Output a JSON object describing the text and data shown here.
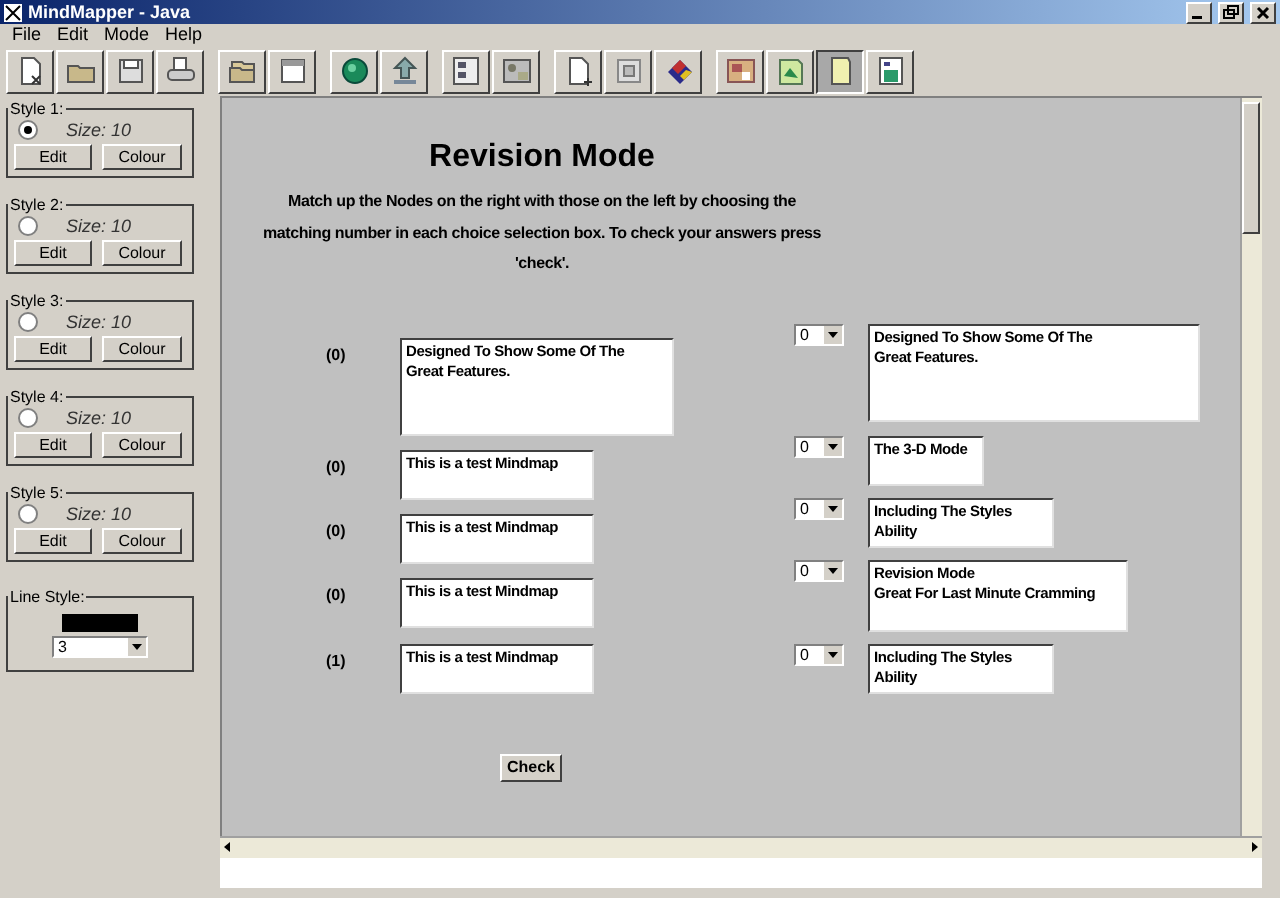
{
  "window": {
    "title": "MindMapper - Java"
  },
  "menu": [
    "File",
    "Edit",
    "Mode",
    "Help"
  ],
  "toolbar": [
    {
      "selected": false
    },
    {
      "selected": false
    },
    {
      "selected": false
    },
    {
      "selected": false
    },
    {
      "selected": false
    },
    {
      "selected": false
    },
    {
      "selected": false
    },
    {
      "selected": false
    },
    {
      "selected": false
    },
    {
      "selected": false
    },
    {
      "selected": false
    },
    {
      "selected": false
    },
    {
      "selected": false
    },
    {
      "selected": false
    },
    {
      "selected": false
    },
    {
      "selected": true
    },
    {
      "selected": false
    }
  ],
  "styles": [
    {
      "legend": "Style 1:",
      "selected": true,
      "size_label": "Size:",
      "size": "10",
      "edit": "Edit",
      "colour": "Colour"
    },
    {
      "legend": "Style 2:",
      "selected": false,
      "size_label": "Size:",
      "size": "10",
      "edit": "Edit",
      "colour": "Colour"
    },
    {
      "legend": "Style 3:",
      "selected": false,
      "size_label": "Size:",
      "size": "10",
      "edit": "Edit",
      "colour": "Colour"
    },
    {
      "legend": "Style 4:",
      "selected": false,
      "size_label": "Size:",
      "size": "10",
      "edit": "Edit",
      "colour": "Colour"
    },
    {
      "legend": "Style 5:",
      "selected": false,
      "size_label": "Size:",
      "size": "10",
      "edit": "Edit",
      "colour": "Colour"
    }
  ],
  "line_style": {
    "legend": "Line Style:",
    "value": "3"
  },
  "revision": {
    "title": "Revision Mode",
    "instructions": "Match up the Nodes on the right with those on the left by choosing the matching number in each choice selection box. To check your answers press 'check'.",
    "left_nodes": [
      {
        "number": "(0)",
        "text": "Designed To Show Some Of The\nGreat Features."
      },
      {
        "number": "(0)",
        "text": "This is a test Mindmap"
      },
      {
        "number": "(0)",
        "text": "This is a test Mindmap"
      },
      {
        "number": "(0)",
        "text": "This is a test Mindmap"
      },
      {
        "number": "(1)",
        "text": "This is a test Mindmap"
      }
    ],
    "right_nodes": [
      {
        "choice": "0",
        "text": "Designed To Show Some Of The\nGreat Features."
      },
      {
        "choice": "0",
        "text": "The 3-D Mode"
      },
      {
        "choice": "0",
        "text": "Including The Styles\nAbility"
      },
      {
        "choice": "0",
        "text": "Revision Mode\nGreat For Last Minute Cramming"
      },
      {
        "choice": "0",
        "text": "Including The Styles\nAbility"
      }
    ],
    "check_button": "Check"
  }
}
